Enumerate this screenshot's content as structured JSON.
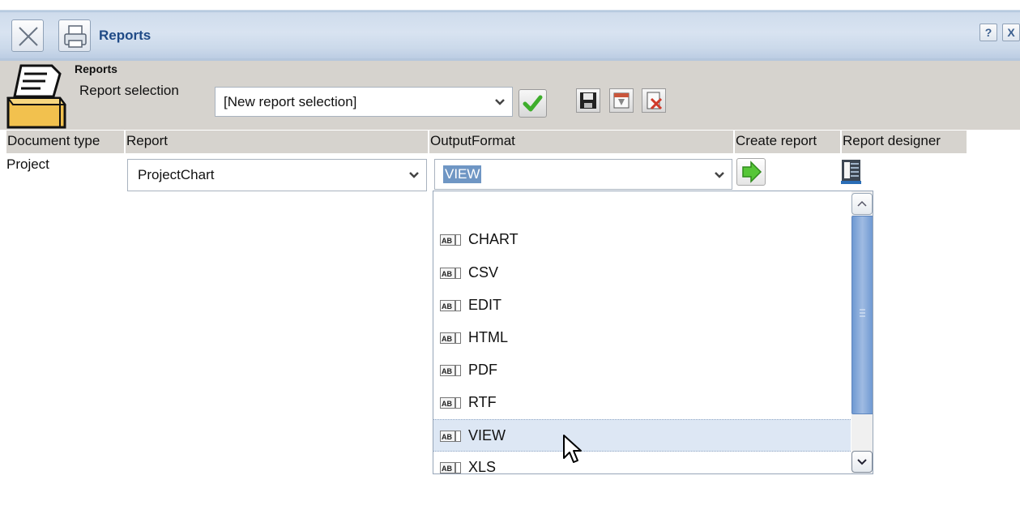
{
  "window": {
    "title": "Reports",
    "help_label": "?",
    "close_label": "X"
  },
  "panel": {
    "title": "Reports",
    "report_selection_label": "Report selection",
    "report_selection_value": "[New report selection]"
  },
  "columns": {
    "document_type": "Document type",
    "report": "Report",
    "output_format": "OutputFormat",
    "create_report": "Create report",
    "report_designer": "Report designer"
  },
  "row": {
    "document_type": "Project",
    "report": "ProjectChart",
    "output_format": "VIEW"
  },
  "dropdown": {
    "options": [
      "",
      "CHART",
      "CSV",
      "EDIT",
      "HTML",
      "PDF",
      "RTF",
      "VIEW",
      "XLS"
    ],
    "selected": "VIEW",
    "option_icon_text": "AB"
  },
  "colors": {
    "title_text": "#1f4a86",
    "panel_bg": "#d6d3ce",
    "selection_highlight": "#6f96c4",
    "scroll_thumb": "#7fa3d6",
    "confirm_green": "#3eae2c"
  }
}
